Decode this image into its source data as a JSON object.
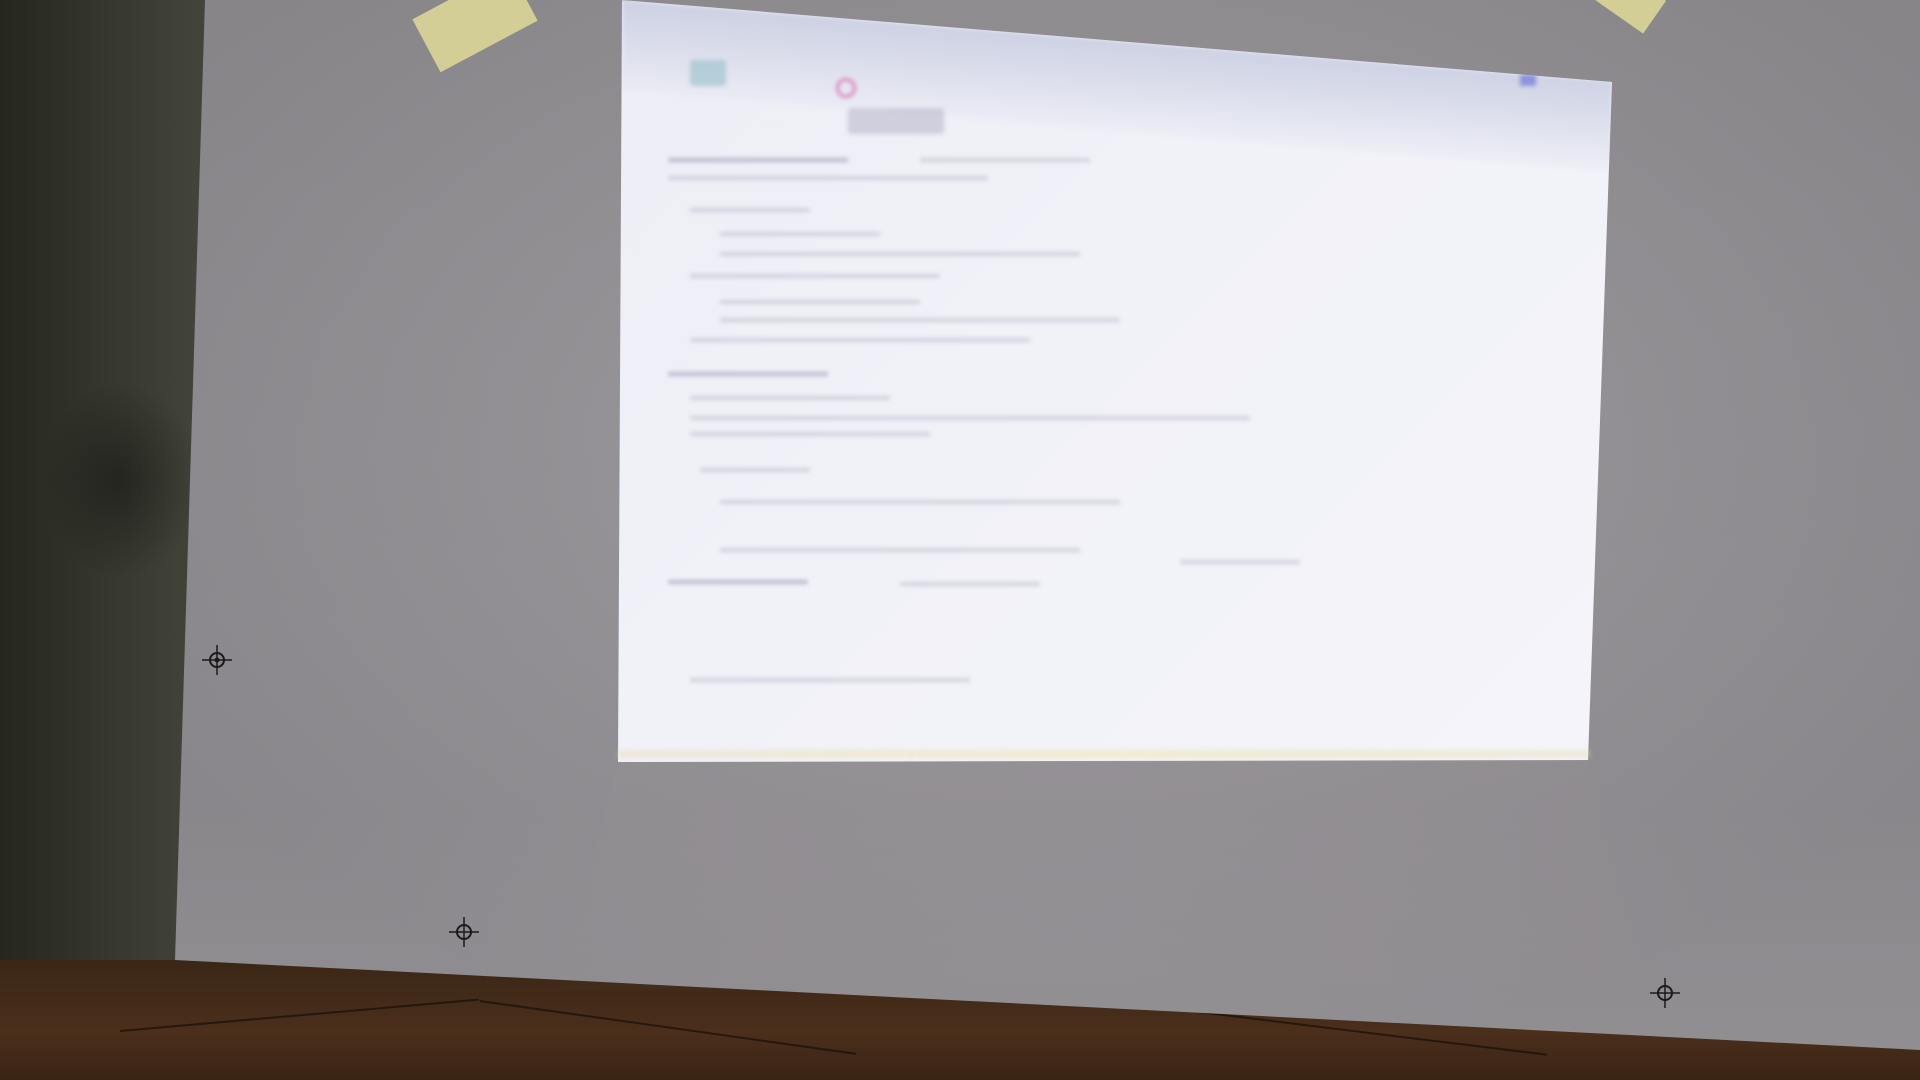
{
  "scene": {
    "description_kind": "photo of a projected desktop screen on a white board",
    "colors": {
      "board": "#918e93",
      "projection": "#f1f1f8",
      "wall": "#3b3d33",
      "floor": "#4a2f1b",
      "tape": "#dedA96",
      "pin_accent": "#dc5aaa",
      "corner_accent": "#6e78dc"
    },
    "markers": [
      {
        "icon": "crosshair-icon"
      },
      {
        "icon": "crosshair-icon"
      },
      {
        "icon": "crosshair-icon"
      }
    ]
  }
}
